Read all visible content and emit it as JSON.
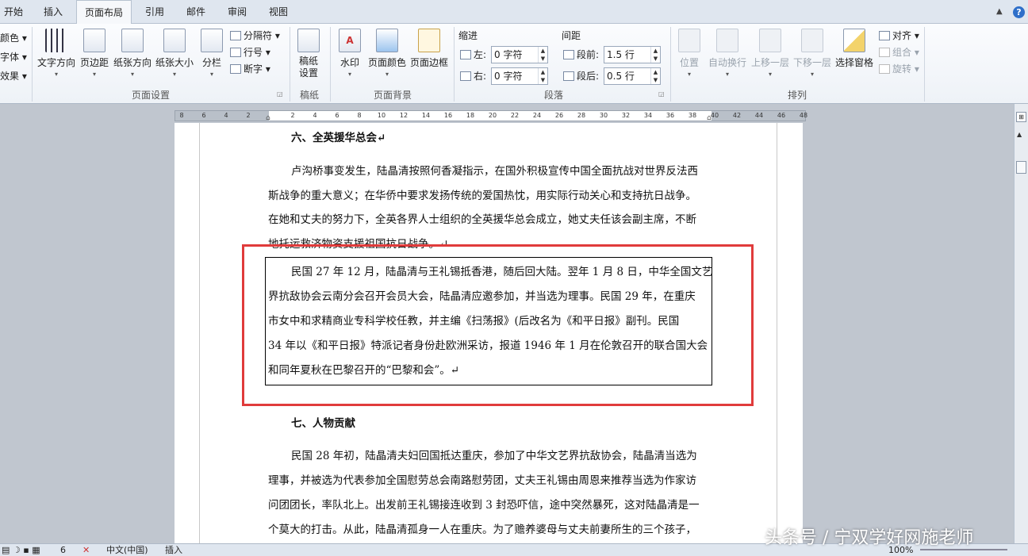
{
  "tabs": [
    "开始",
    "插入",
    "页面布局",
    "引用",
    "邮件",
    "审阅",
    "视图"
  ],
  "theme_items": [
    "颜色",
    "字体",
    "效果"
  ],
  "page_setup": {
    "buttons": [
      "文字方向",
      "页边距",
      "纸张方向",
      "纸张大小",
      "分栏"
    ],
    "small": [
      "分隔符",
      "行号",
      "断字"
    ],
    "label": "页面设置"
  },
  "draft": {
    "button": "稿纸\n设置",
    "label": "稿纸"
  },
  "background": {
    "buttons": [
      "水印",
      "页面颜色",
      "页面边框"
    ],
    "label": "页面背景"
  },
  "paragraph": {
    "indent_title": "缩进",
    "spacing_title": "间距",
    "left_label": "左:",
    "left_value": "0 字符",
    "right_label": "右:",
    "right_value": "0 字符",
    "before_label": "段前:",
    "before_value": "1.5 行",
    "after_label": "段后:",
    "after_value": "0.5 行",
    "label": "段落"
  },
  "arrange": {
    "buttons": [
      "位置",
      "自动换行",
      "上移一层",
      "下移一层",
      "选择窗格"
    ],
    "small": [
      "对齐",
      "组合",
      "旋转"
    ],
    "label": "排列"
  },
  "ruler_ticks": [
    "8",
    "6",
    "4",
    "2",
    "",
    "2",
    "4",
    "6",
    "8",
    "10",
    "12",
    "14",
    "16",
    "18",
    "20",
    "22",
    "24",
    "26",
    "28",
    "30",
    "32",
    "34",
    "36",
    "38",
    "40",
    "42",
    "44",
    "46",
    "48"
  ],
  "doc": {
    "h6": "六、全英援华总会↵",
    "p1": [
      "卢沟桥事变发生，陆晶清按照何香凝指示，在国外积极宣传中国全面抗战对世界反法西",
      "斯战争的重大意义；在华侨中要求发扬传统的爱国热忱，用实际行动关心和支持抗日战争。",
      "在她和丈夫的努力下，全英各界人士组织的全英援华总会成立，她丈夫任该会副主席，不断",
      "地托运救济物资支援祖国抗日战争。↵"
    ],
    "p2": [
      "民国 27 年 12 月，陆晶清与王礼锡抵香港，随后回大陆。翌年 1 月 8 日，中华全国文艺",
      "界抗敌协会云南分会召开会员大会，陆晶清应邀参加，并当选为理事。民国 29 年，在重庆",
      "市女中和求精商业专科学校任教，并主编《扫荡报》(后改名为《和平日报》副刊。民国",
      "34 年以《和平日报》特派记者身份赴欧洲采访，报道 1946 年 1 月在伦敦召开的联合国大会",
      "和同年夏秋在巴黎召开的“巴黎和会”。↵"
    ],
    "h7": "七、人物贡献",
    "p3": [
      "民国 28 年初，陆晶清夫妇回国抵达重庆，参加了中华文艺界抗敌协会，陆晶清当选为",
      "理事，并被选为代表参加全国慰劳总会南路慰劳团，丈夫王礼锡由周恩来推荐当选为作家访",
      "问团团长，率队北上。出发前王礼锡接连收到 3 封恐吓信，途中突然暴死，这对陆晶清是一",
      "个莫大的打击。从此，陆晶清孤身一人在重庆。为了赡养婆母与丈夫前妻所生的三个孩子，"
    ]
  },
  "status": {
    "page": "6",
    "lang": "中文(中国)",
    "mode": "插入",
    "zoom": "100%"
  },
  "watermark": "头条号 / 宁双学好网施老师"
}
